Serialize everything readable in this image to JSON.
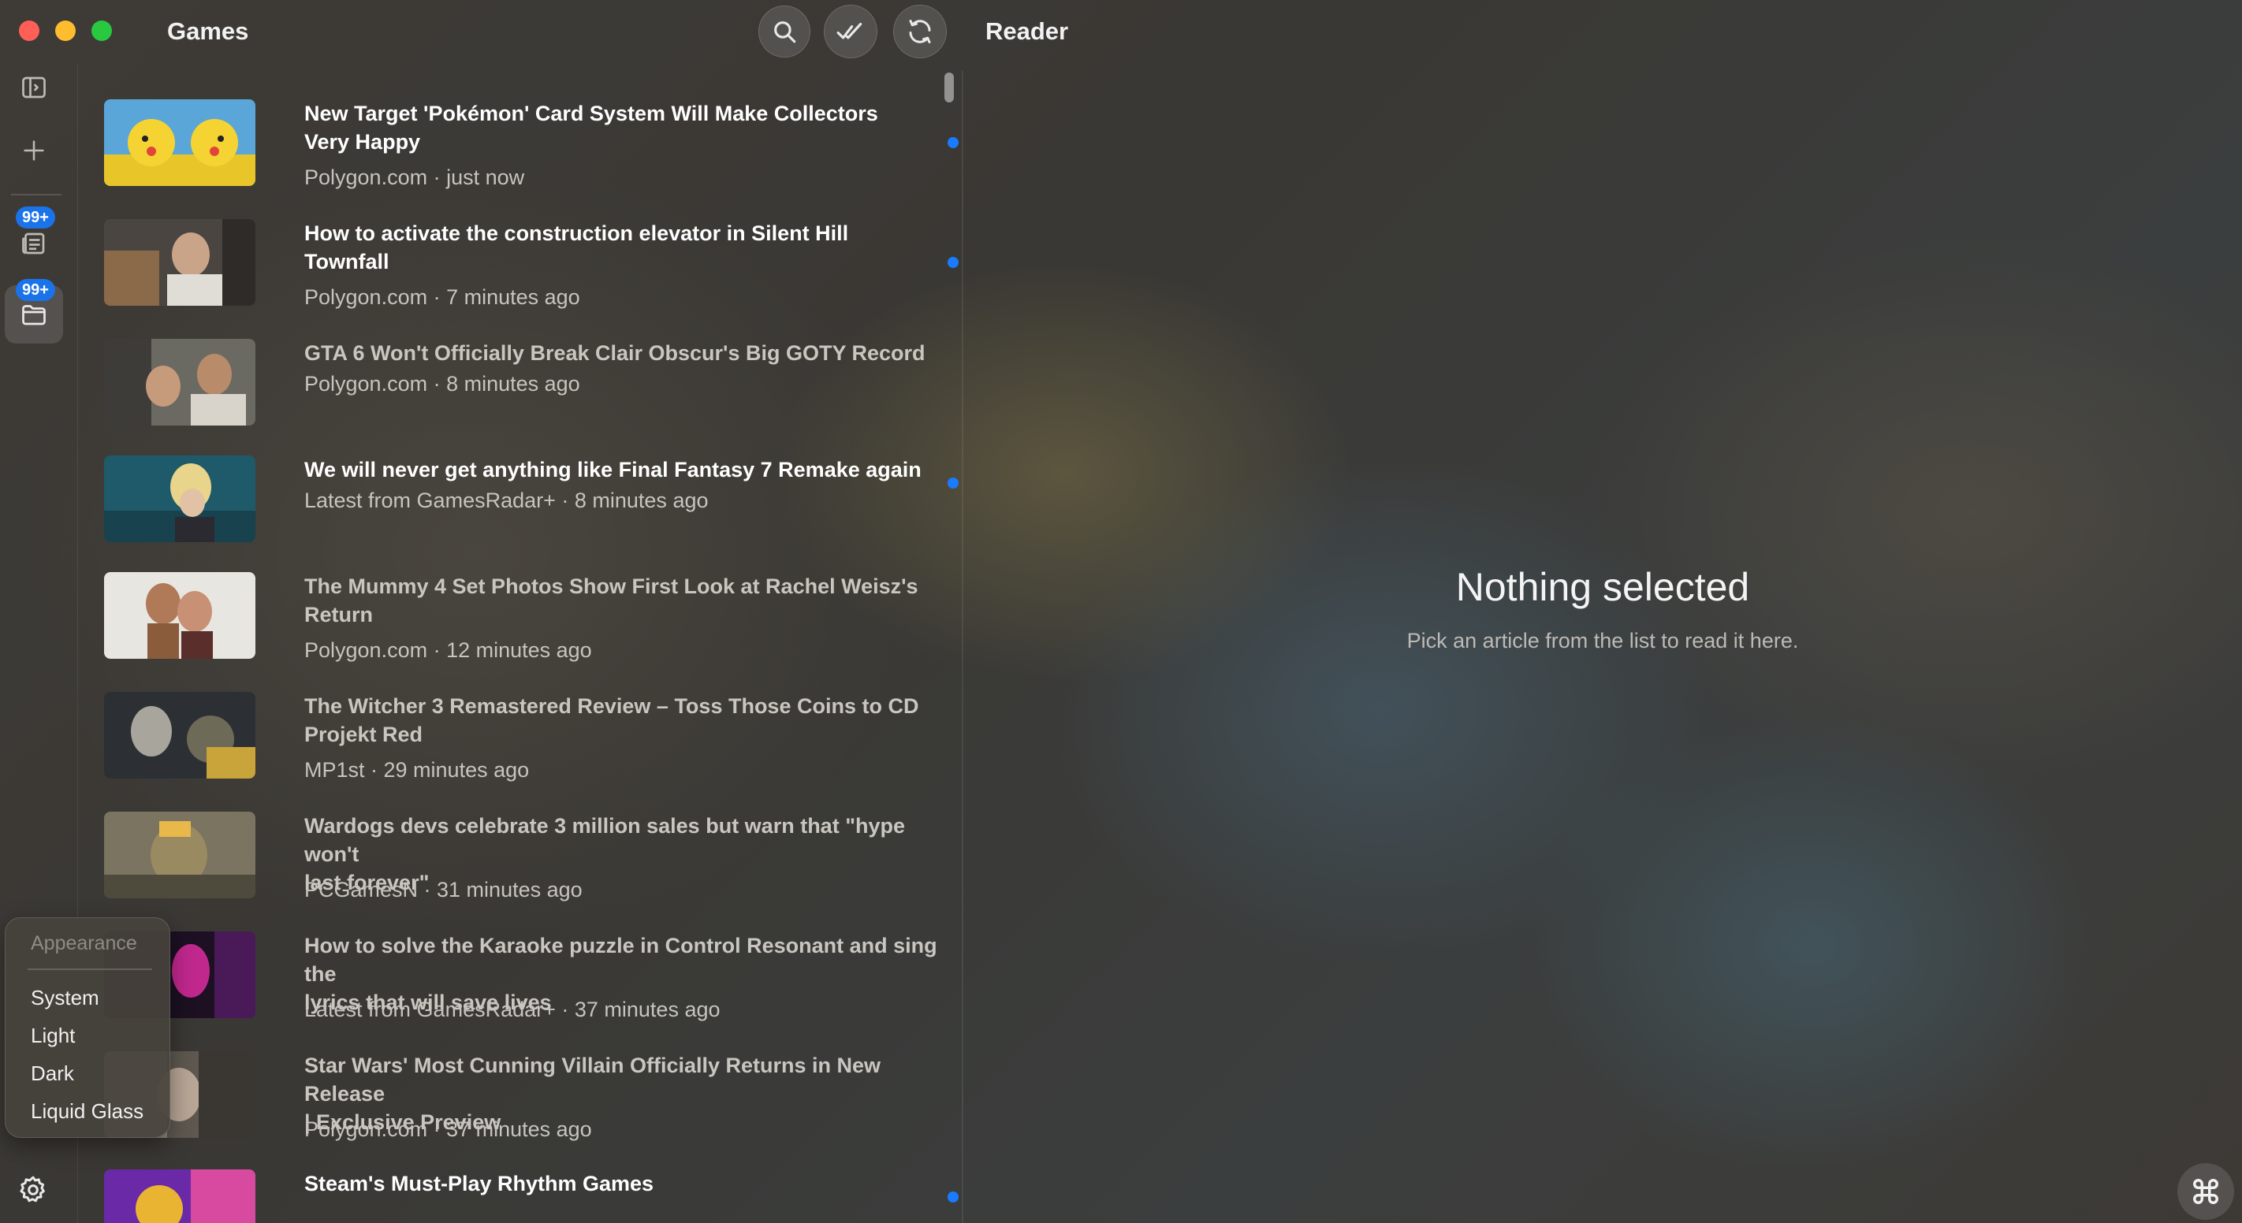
{
  "window": {
    "feed_title": "Games",
    "reader_title": "Reader"
  },
  "toolbar": {
    "search_icon": "search-icon",
    "mark_all_read_icon": "double-check-icon",
    "refresh_icon": "refresh-icon"
  },
  "sidebar": {
    "badges": [
      "99+",
      "99+"
    ],
    "icons": [
      "sidebar-toggle-icon",
      "plus-icon",
      "newspaper-icon",
      "folder-icon",
      "gear-icon"
    ]
  },
  "articles": [
    {
      "title_line1": "New Target 'Pokémon' Card System Will Make Collectors",
      "title_line2": "Very Happy",
      "meta": "Polygon.com · just now",
      "unread": true
    },
    {
      "title_line1": "How to activate the construction elevator in Silent Hill",
      "title_line2": "Townfall",
      "meta": "Polygon.com · 7 minutes ago",
      "unread": true
    },
    {
      "title_line1": "GTA 6 Won't Officially Break Clair Obscur's Big GOTY Record",
      "title_line2": "",
      "meta": "Polygon.com · 8 minutes ago",
      "unread": false
    },
    {
      "title_line1": "We will never get anything like Final Fantasy 7 Remake again",
      "title_line2": "",
      "meta": "Latest from GamesRadar+ · 8 minutes ago",
      "unread": true
    },
    {
      "title_line1": "The Mummy 4 Set Photos Show First Look at Rachel Weisz's",
      "title_line2": "Return",
      "meta": "Polygon.com · 12 minutes ago",
      "unread": false
    },
    {
      "title_line1": "The Witcher 3 Remastered Review – Toss Those Coins to CD",
      "title_line2": "Projekt Red",
      "meta": "MP1st · 29 minutes ago",
      "unread": false
    },
    {
      "title_line1": "Wardogs devs celebrate 3 million sales but warn that \"hype won't",
      "title_line2": "last forever\"",
      "meta": "PCGamesN · 31 minutes ago",
      "unread": false
    },
    {
      "title_line1": "How to solve the Karaoke puzzle in Control Resonant and sing the",
      "title_line2": "lyrics that will save lives",
      "meta": "Latest from GamesRadar+ · 37 minutes ago",
      "unread": false
    },
    {
      "title_line1": "Star Wars' Most Cunning Villain Officially Returns in New Release",
      "title_line2": "| Exclusive Preview",
      "meta": "Polygon.com · 37 minutes ago",
      "unread": false
    },
    {
      "title_line1": "Steam's Must-Play Rhythm Games",
      "title_line2": "",
      "meta": "",
      "unread": true
    }
  ],
  "reader": {
    "empty_title": "Nothing selected",
    "empty_subtitle": "Pick an article from the list to read it here."
  },
  "appearance_menu": {
    "header": "Appearance",
    "options": [
      "System",
      "Light",
      "Dark",
      "Liquid Glass"
    ]
  },
  "colors": {
    "unread_dot": "#1a7bff",
    "badge": "#1a73e8",
    "close": "#ff5f57",
    "minimize": "#febc2e",
    "zoom": "#28c840"
  }
}
